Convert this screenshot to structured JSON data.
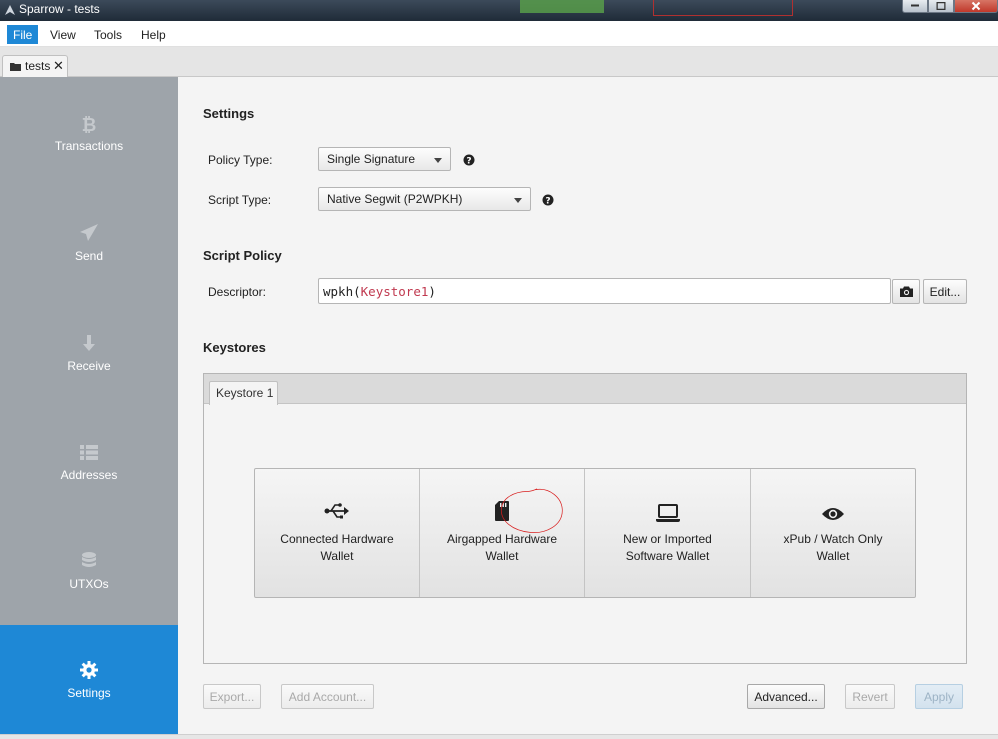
{
  "window": {
    "title": "Sparrow - tests",
    "controls": [
      "minimize-icon",
      "maximize-icon",
      "close-icon"
    ]
  },
  "menu": {
    "items": [
      "File",
      "View",
      "Tools",
      "Help"
    ],
    "active": "File"
  },
  "tabs": [
    {
      "label": "tests",
      "icon": "wallet-folder-icon",
      "close": "✕"
    }
  ],
  "sidebar": {
    "items": [
      {
        "label": "Transactions",
        "icon": "bitcoin-icon"
      },
      {
        "label": "Send",
        "icon": "paper-plane-icon"
      },
      {
        "label": "Receive",
        "icon": "arrow-down-icon"
      },
      {
        "label": "Addresses",
        "icon": "list-icon"
      },
      {
        "label": "UTXOs",
        "icon": "coins-icon"
      },
      {
        "label": "Settings",
        "icon": "gear-icon"
      }
    ],
    "selected": "Settings",
    "selected_color": "#1e88d6"
  },
  "settings": {
    "title": "Settings",
    "policy_type": {
      "label": "Policy Type:",
      "value": "Single Signature"
    },
    "script_type": {
      "label": "Script Type:",
      "value": "Native Segwit (P2WPKH)"
    }
  },
  "script_policy": {
    "title": "Script Policy",
    "descriptor_label": "Descriptor:",
    "descriptor_prefix": "wpkh(",
    "descriptor_keystore": "Keystore1",
    "descriptor_suffix": ")",
    "edit_label": "Edit..."
  },
  "keystores": {
    "title": "Keystores",
    "tab_label": "Keystore 1",
    "options": [
      {
        "line1": "Connected Hardware",
        "line2": "Wallet",
        "icon": "usb-icon"
      },
      {
        "line1": "Airgapped Hardware",
        "line2": "Wallet",
        "icon": "sd-card-icon"
      },
      {
        "line1": "New or Imported",
        "line2": "Software Wallet",
        "icon": "laptop-icon"
      },
      {
        "line1": "xPub / Watch Only",
        "line2": "Wallet",
        "icon": "eye-icon"
      }
    ]
  },
  "footer": {
    "export": "Export...",
    "add_account": "Add Account...",
    "advanced": "Advanced...",
    "revert": "Revert",
    "apply": "Apply"
  },
  "annotation_color": "#d81e1e"
}
